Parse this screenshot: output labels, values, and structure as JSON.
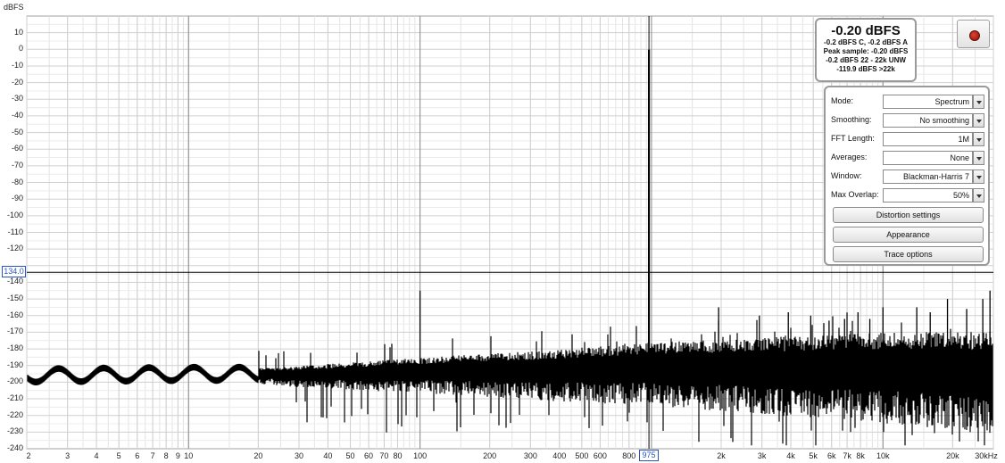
{
  "chart_data": {
    "type": "line",
    "title": "",
    "ylabel": "dBFS",
    "xlabel": "",
    "xscale": "log",
    "xlim": [
      2,
      30000
    ],
    "ylim": [
      -240,
      20
    ],
    "grid": true,
    "y_ticks": [
      "10",
      "0",
      "-10",
      "-20",
      "-30",
      "-40",
      "-50",
      "-60",
      "-70",
      "-80",
      "-90",
      "-100",
      "-110",
      "-120",
      "-130",
      "-140",
      "-150",
      "-160",
      "-170",
      "-180",
      "-190",
      "-200",
      "-210",
      "-220",
      "-230",
      "-240"
    ],
    "x_ticks": [
      {
        "label": "2",
        "value": 2
      },
      {
        "label": "3",
        "value": 3
      },
      {
        "label": "4",
        "value": 4
      },
      {
        "label": "5",
        "value": 5
      },
      {
        "label": "6",
        "value": 6
      },
      {
        "label": "7",
        "value": 7
      },
      {
        "label": "8",
        "value": 8
      },
      {
        "label": "9",
        "value": 9
      },
      {
        "label": "10",
        "value": 10
      },
      {
        "label": "20",
        "value": 20
      },
      {
        "label": "30",
        "value": 30
      },
      {
        "label": "40",
        "value": 40
      },
      {
        "label": "50",
        "value": 50
      },
      {
        "label": "60",
        "value": 60
      },
      {
        "label": "70",
        "value": 70
      },
      {
        "label": "80",
        "value": 80
      },
      {
        "label": "100",
        "value": 100
      },
      {
        "label": "200",
        "value": 200
      },
      {
        "label": "300",
        "value": 300
      },
      {
        "label": "400",
        "value": 400
      },
      {
        "label": "500",
        "value": 500
      },
      {
        "label": "600",
        "value": 600
      },
      {
        "label": "800",
        "value": 800
      },
      {
        "label": "2k",
        "value": 2000
      },
      {
        "label": "3k",
        "value": 3000
      },
      {
        "label": "4k",
        "value": 4000
      },
      {
        "label": "5k",
        "value": 5000
      },
      {
        "label": "6k",
        "value": 6000
      },
      {
        "label": "7k",
        "value": 7000
      },
      {
        "label": "8k",
        "value": 8000
      },
      {
        "label": "10k",
        "value": 10000
      },
      {
        "label": "20k",
        "value": 20000
      },
      {
        "label": "30kHz",
        "value": 30000
      }
    ],
    "cursor": {
      "y_value": -134.0,
      "y_label": "134.0",
      "x_value": 975,
      "x_label": "975"
    },
    "series": [
      {
        "color": "#000000",
        "noise_floor_envelope": [
          {
            "x": 2,
            "y": -196
          },
          {
            "x": 10,
            "y": -195
          },
          {
            "x": 30,
            "y": -195
          },
          {
            "x": 100,
            "y": -193
          },
          {
            "x": 300,
            "y": -192
          },
          {
            "x": 1000,
            "y": -190
          },
          {
            "x": 3000,
            "y": -190
          },
          {
            "x": 10000,
            "y": -190
          },
          {
            "x": 30000,
            "y": -192
          }
        ],
        "peaks": [
          {
            "x": 100,
            "y": -145
          },
          {
            "x": 975,
            "y": -0.2
          },
          {
            "x": 1950,
            "y": -155
          },
          {
            "x": 2925,
            "y": -160
          },
          {
            "x": 3900,
            "y": -158
          },
          {
            "x": 4875,
            "y": -160
          },
          {
            "x": 5850,
            "y": -163
          },
          {
            "x": 6825,
            "y": -162
          },
          {
            "x": 7800,
            "y": -158
          },
          {
            "x": 8775,
            "y": -162
          },
          {
            "x": 10000,
            "y": -155
          },
          {
            "x": 14000,
            "y": -155
          },
          {
            "x": 16000,
            "y": -158
          },
          {
            "x": 19000,
            "y": -150
          },
          {
            "x": 23000,
            "y": -156
          },
          {
            "x": 27000,
            "y": -150
          },
          {
            "x": 29000,
            "y": -145
          }
        ]
      }
    ]
  },
  "ui": {
    "y_unit_label": "dBFS",
    "readout": {
      "main": "-0.20 dBFS",
      "lines": [
        "-0.2 dBFS C, -0.2 dBFS A",
        "Peak sample: -0.20 dBFS",
        "-0.2 dBFS 22 - 22k UNW",
        "-119.9 dBFS >22k"
      ]
    },
    "controls": [
      {
        "label": "Mode:",
        "value": "Spectrum"
      },
      {
        "label": "Smoothing:",
        "value": "No  smoothing"
      },
      {
        "label": "FFT Length:",
        "value": "1M"
      },
      {
        "label": "Averages:",
        "value": "None"
      },
      {
        "label": "Window:",
        "value": "Blackman-Harris 7"
      },
      {
        "label": "Max Overlap:",
        "value": "50%"
      }
    ],
    "buttons": {
      "distortion": "Distortion settings",
      "appearance": "Appearance",
      "trace": "Trace options"
    }
  }
}
